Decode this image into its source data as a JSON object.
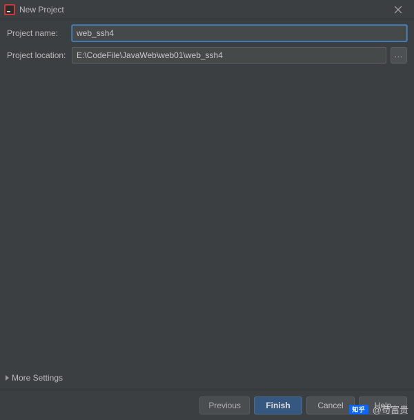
{
  "window": {
    "title": "New Project"
  },
  "form": {
    "name_label": "Project name:",
    "name_value": "web_ssh4",
    "location_label": "Project location:",
    "location_value": "E:\\CodeFile\\JavaWeb\\web01\\web_ssh4",
    "browse_label": "..."
  },
  "more_settings_label": "More Settings",
  "buttons": {
    "previous": "Previous",
    "finish": "Finish",
    "cancel": "Cancel",
    "help": "Help"
  },
  "watermark": {
    "logo_text": "知乎",
    "text": "@苟富贵"
  }
}
